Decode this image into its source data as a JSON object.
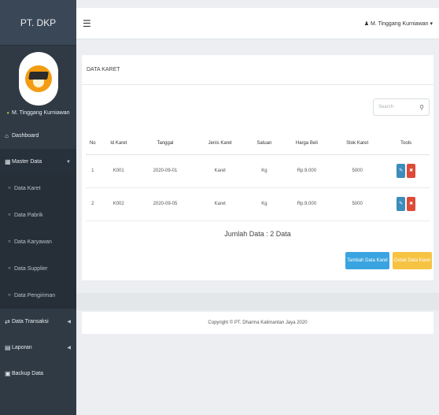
{
  "brand": "PT. DKP",
  "profile": {
    "name": "M. Tinggang Kurniawan"
  },
  "topbar": {
    "menu_icon": "hamburger-icon",
    "user": "M. Tinggang Kurniawan"
  },
  "sidebar": {
    "items": [
      {
        "label": "Dashboard",
        "icon": "home-icon"
      },
      {
        "label": "Master Data",
        "icon": "database-icon",
        "expanded": true
      }
    ],
    "sub_items": [
      "Data Karet",
      "Data Pabrik",
      "Data Karyawan",
      "Data Supplier",
      "Data Pengiriman"
    ],
    "bottom_items": [
      {
        "label": "Data Transaksi",
        "icon": "exchange-icon"
      },
      {
        "label": "Laporan",
        "icon": "report-icon"
      },
      {
        "label": "Backup Data",
        "icon": "backup-icon"
      }
    ]
  },
  "panel": {
    "title": "DATA KARET"
  },
  "search": {
    "placeholder": "Search"
  },
  "table": {
    "headers": [
      "No",
      "Id Karet",
      "Tanggal",
      "Jenis Karet",
      "Satuan",
      "Harga Beli",
      "Stok Karet",
      "Tools"
    ],
    "rows": [
      [
        "1",
        "K001",
        "2020-09-01",
        "Karet",
        "Kg",
        "Rp.9.000",
        "5000"
      ],
      [
        "2",
        "K002",
        "2020-09-05",
        "Karet",
        "Kg",
        "Rp.9.000",
        "5000"
      ]
    ]
  },
  "total": "Jumlah Data : 2 Data",
  "buttons": {
    "add": "Tambah Data Karet",
    "print": "Cetak Data Karet"
  },
  "footer": "Copyright © PT. Dharma Kalimantan Jaya 2020",
  "colors": {
    "sidebar": "#2f3a45",
    "edit": "#3c8dbc",
    "delete": "#dd4b39",
    "add": "#3aa4e0",
    "print": "#f6c343",
    "avatar": "#f39c12"
  }
}
